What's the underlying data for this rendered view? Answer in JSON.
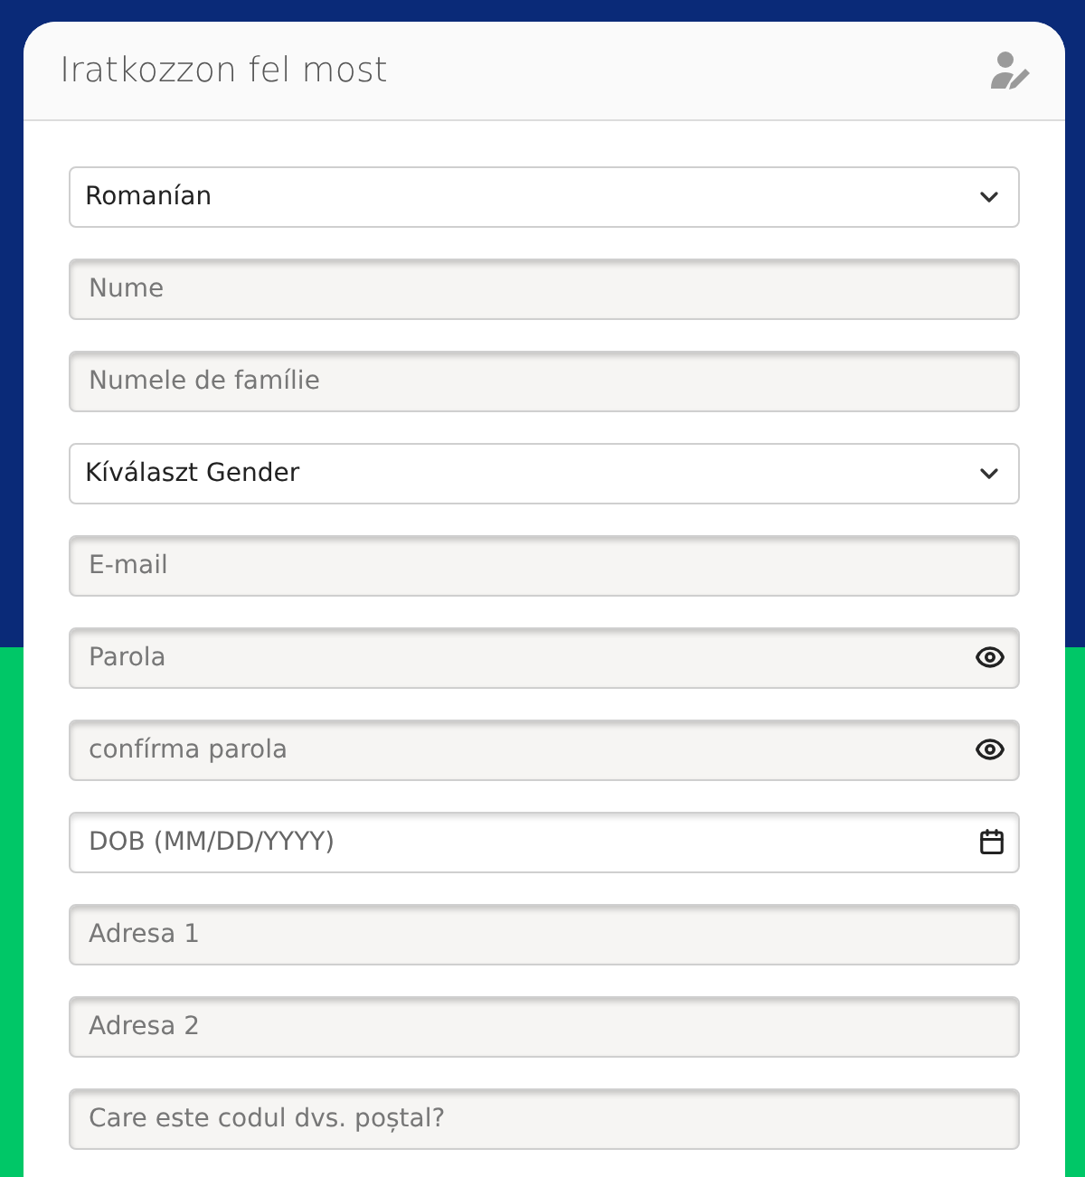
{
  "header": {
    "title": "Iratkozzon fel most"
  },
  "fields": [
    {
      "kind": "select",
      "value": "Romanían"
    },
    {
      "kind": "text",
      "placeholder": "Nume"
    },
    {
      "kind": "text",
      "placeholder": "Numele de famílie"
    },
    {
      "kind": "select",
      "value": "Kíválaszt Gender"
    },
    {
      "kind": "text",
      "placeholder": "E-mail"
    },
    {
      "kind": "password",
      "placeholder": "Parola"
    },
    {
      "kind": "password",
      "placeholder": "confírma parola"
    },
    {
      "kind": "date",
      "placeholder": "DOB (MM/DD/YYYY)"
    },
    {
      "kind": "text",
      "placeholder": "Adresa 1"
    },
    {
      "kind": "text",
      "placeholder": "Adresa 2"
    },
    {
      "kind": "text",
      "placeholder": "Care este codul dvs. poștal?"
    }
  ]
}
